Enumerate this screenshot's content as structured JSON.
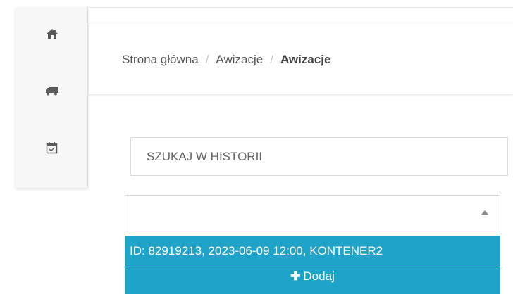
{
  "sidebar": {
    "items": [
      {
        "icon": "home-icon"
      },
      {
        "icon": "truck-icon"
      },
      {
        "icon": "calendar-check-icon"
      }
    ]
  },
  "breadcrumb": {
    "home": "Strona główna",
    "section": "Awizacje",
    "current": "Awizacje",
    "separator": "/"
  },
  "search": {
    "placeholder": "SZUKAJ W HISTORII",
    "value": ""
  },
  "select": {
    "value": "",
    "options": [
      "ID: 82919213, 2023-06-09 12:00, KONTENER2"
    ],
    "highlighted_option": "ID: 82919213, 2023-06-09 12:00, KONTENER2"
  },
  "add_button": {
    "icon": "plus-icon",
    "label": "Dodaj"
  },
  "colors": {
    "accent": "#1fa3c8",
    "sidebar_bg": "#f7f7f7",
    "text": "#555555"
  }
}
